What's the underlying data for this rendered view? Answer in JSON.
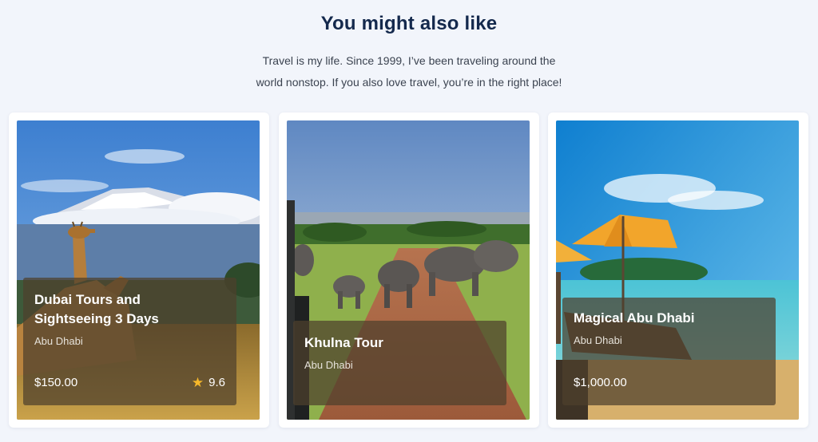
{
  "section": {
    "title": "You might also like",
    "subtitle_line1": "Travel is my life. Since 1999, I’ve been traveling around the",
    "subtitle_line2": "world nonstop. If you also love travel, you’re in the right place!"
  },
  "cards": [
    {
      "title_line1": "Dubai Tours and",
      "title_line2": "Sightseeing 3 Days",
      "location": "Abu Dhabi",
      "price": "$150.00",
      "rating": "9.6",
      "rating_icon": "star-icon"
    },
    {
      "title": "Khulna Tour",
      "location": "Abu Dhabi"
    },
    {
      "title": "Magical Abu Dhabi",
      "location": "Abu Dhabi",
      "price": "$1,000.00"
    }
  ],
  "colors": {
    "background": "#f2f5fb",
    "heading": "#14294d",
    "star": "#f7b82a"
  }
}
